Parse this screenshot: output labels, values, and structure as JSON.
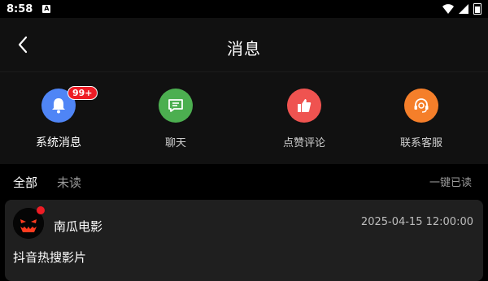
{
  "status_bar": {
    "time": "8:58",
    "notification_glyph": "A"
  },
  "header": {
    "title": "消息"
  },
  "categories": [
    {
      "label": "系统消息",
      "icon": "bell-icon",
      "color": "#4f85f6",
      "badge": "99+"
    },
    {
      "label": "聊天",
      "icon": "chat-icon",
      "color": "#4caf50"
    },
    {
      "label": "点赞评论",
      "icon": "thumbs-up-icon",
      "color": "#ef5350"
    },
    {
      "label": "联系客服",
      "icon": "headset-icon",
      "color": "#f57f2a"
    }
  ],
  "filter": {
    "tab_all": "全部",
    "tab_unread": "未读",
    "mark_all_read": "一键已读"
  },
  "messages": [
    {
      "sender": "南瓜电影",
      "time": "2025-04-15 12:00:00",
      "content": "抖音热搜影片"
    }
  ],
  "colors": {
    "badge": "#ee1c25",
    "card_bg": "#1f1f1f",
    "header_bg": "#111111"
  }
}
